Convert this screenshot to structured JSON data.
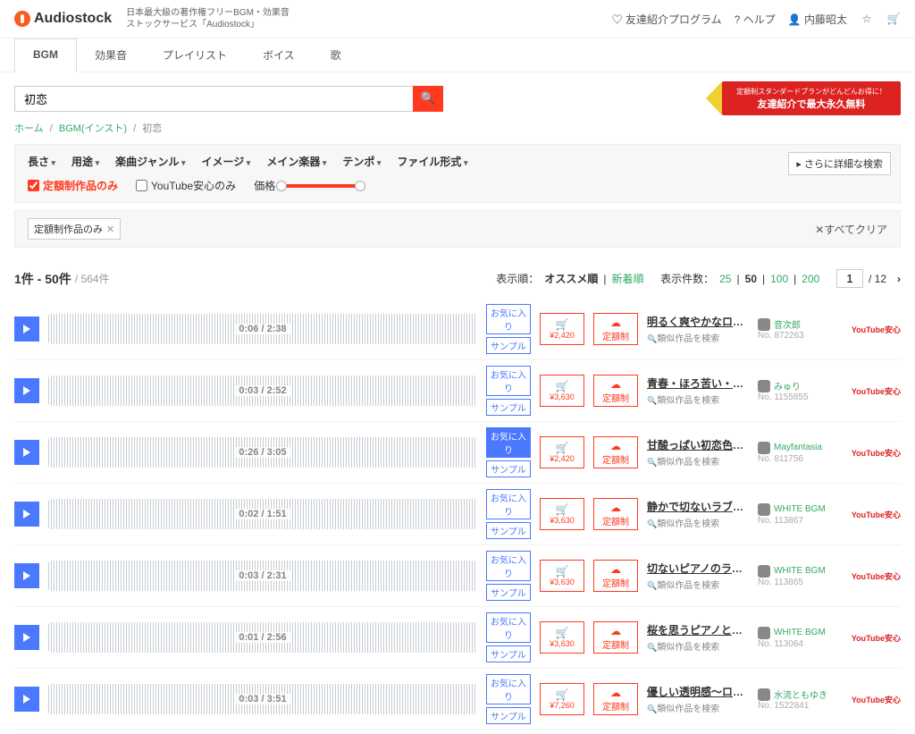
{
  "header": {
    "logo": "Audiostock",
    "tagline1": "日本最大級の著作権フリーBGM・効果音",
    "tagline2": "ストックサービス「Audiostock」",
    "friend": "友達紹介プログラム",
    "help": "ヘルプ",
    "user": "内藤昭太"
  },
  "tabs": [
    "BGM",
    "効果音",
    "プレイリスト",
    "ボイス",
    "歌"
  ],
  "search": {
    "value": "初恋"
  },
  "promo": {
    "line1": "定額制スタンダードプランがどんどんお得に！",
    "line2": "友達紹介で最大永久無料"
  },
  "breadcrumb": {
    "home": "ホーム",
    "cat": "BGM(インスト)",
    "cur": "初恋"
  },
  "filter_dd": [
    "長さ",
    "用途",
    "楽曲ジャンル",
    "イメージ",
    "メイン楽器",
    "テンポ",
    "ファイル形式"
  ],
  "more_detail": "さらに詳細な検索",
  "cb_fixed": "定額制作品のみ",
  "cb_yt": "YouTube安心のみ",
  "price_label": "価格",
  "chip": "定額制作品のみ",
  "clear_all": "すべてクリア",
  "results": {
    "range": "1件 - 50件",
    "total": "/ 564件",
    "sort_label": "表示順：",
    "sort_rec": "オススメ順",
    "sort_new": "新着順",
    "per_label": "表示件数：",
    "per_opts": [
      "25",
      "50",
      "100",
      "200"
    ],
    "page_cur": "1",
    "page_total": "/ 12"
  },
  "btns": {
    "fav": "お気に入り",
    "sample": "サンプル",
    "plan": "定額制",
    "similar": "類似作品を検索",
    "yt": "YouTube安心"
  },
  "tracks": [
    {
      "time": "0:06 / 2:38",
      "price": "¥2,420",
      "title": "明るく爽やかなロマンス楽曲（ピアノソロ）",
      "artist": "音次郎",
      "no": "No. 872263"
    },
    {
      "time": "0:03 / 2:52",
      "price": "¥3,630",
      "title": "青春・ほろ苦い・ノスタルジー・初恋・",
      "artist": "みゅり",
      "no": "No. 1155855"
    },
    {
      "time": "0:26 / 3:05",
      "price": "¥2,420",
      "title": "甘酸っぱい初恋色のリリックピアノ",
      "artist": "Mayfantasia",
      "no": "No. 811756"
    },
    {
      "time": "0:02 / 1:51",
      "price": "¥3,630",
      "title": "静かで切ないラブソンバラード",
      "artist": "WHITE BGM",
      "no": "No. 113867"
    },
    {
      "time": "0:03 / 2:31",
      "price": "¥3,630",
      "title": "切ないピアノのラブバラード",
      "artist": "WHITE BGM",
      "no": "No. 113865"
    },
    {
      "time": "0:01 / 2:56",
      "price": "¥3,630",
      "title": "桜を思うピアノとストリングスのバラード",
      "artist": "WHITE BGM",
      "no": "No. 113064"
    },
    {
      "time": "0:03 / 3:51",
      "price": "¥7,260",
      "title": "優しい透明感〜ロマンチックなバイオリン曲",
      "artist": "水流ともゆき",
      "no": "No. 1522841"
    }
  ]
}
